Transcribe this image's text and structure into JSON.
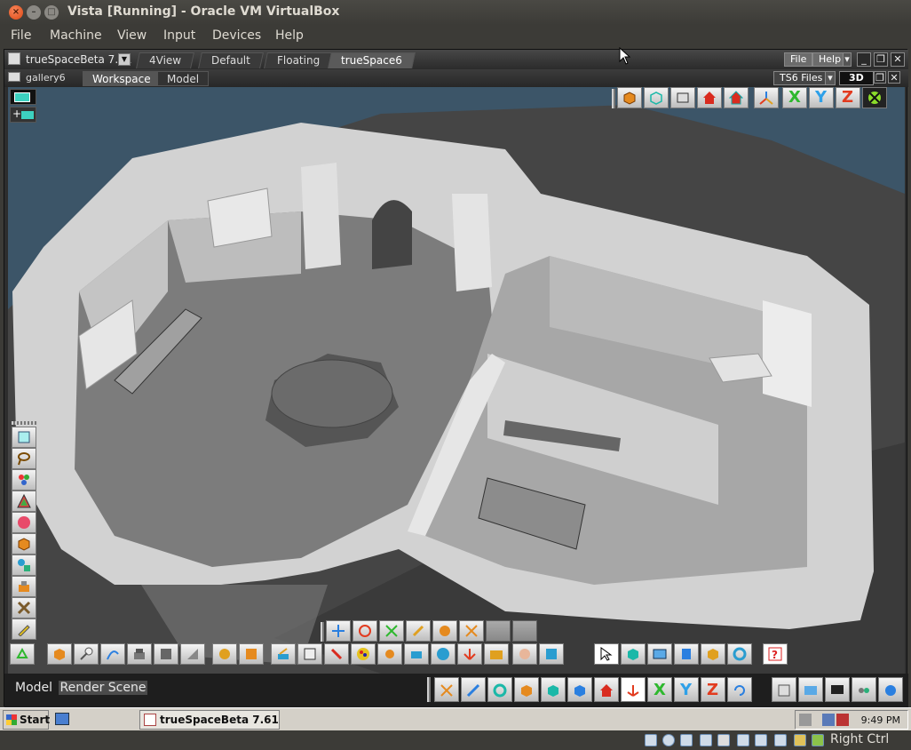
{
  "host": {
    "title": "Vista [Running] - Oracle VM VirtualBox",
    "menu": [
      "File",
      "Machine",
      "View",
      "Input",
      "Devices",
      "Help"
    ]
  },
  "truespace": {
    "app_name": "trueSpaceBeta 7.61",
    "tabs": [
      "4View",
      "Default",
      "Floating",
      "trueSpace6"
    ],
    "active_tab": "trueSpace6",
    "right_menu": [
      "File",
      "Help"
    ],
    "document": "gallery6",
    "mode_tabs": [
      "Workspace",
      "Model"
    ],
    "active_mode": "Workspace",
    "library_button": "TS6 Files",
    "view_button": "3D",
    "status_labels": [
      "Model",
      "Render Scene"
    ],
    "selected_status": "Render Scene",
    "axis_letters": [
      "X",
      "Y",
      "Z"
    ]
  },
  "taskbar": {
    "start_label": "Start",
    "task_button": "trueSpaceBeta 7.61",
    "clock": "9:49 PM"
  },
  "vbox_status": {
    "host_key": "Right Ctrl"
  },
  "colors": {
    "viewport_bg": "#3c5568",
    "wall": "#d6d6d6",
    "floor": "#7a7a7a",
    "axis_x": "#2eb82e",
    "axis_y": "#2ea0e8",
    "axis_z": "#e23b1f"
  }
}
